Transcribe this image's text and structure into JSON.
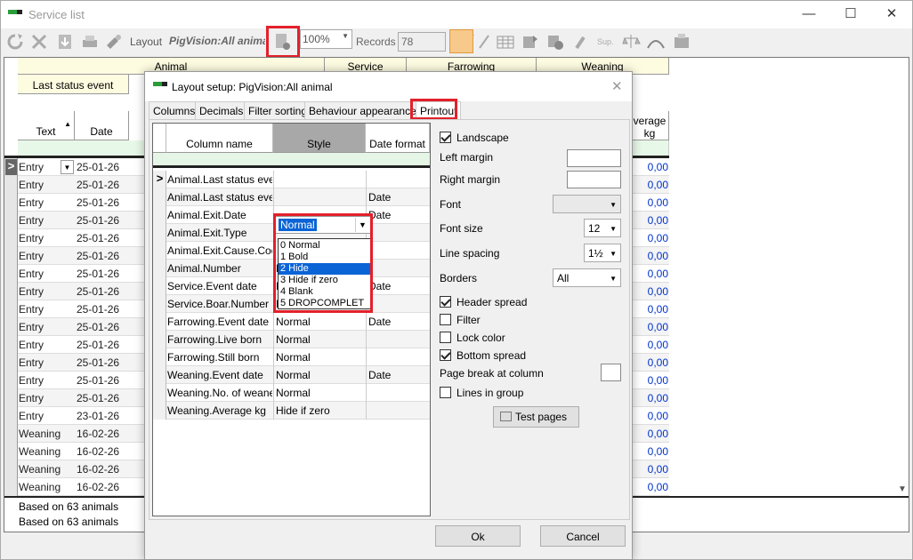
{
  "window": {
    "title": "Service list",
    "controls": {
      "minimize": "—",
      "maximize": "☐",
      "close": "✕"
    }
  },
  "toolbar": {
    "layout_label": "Layout",
    "layout_name": "PigVision:All animal",
    "zoom": "100%",
    "records_label": "Records",
    "records_value": "78",
    "icons": [
      "refresh-icon",
      "delete-icon",
      "download-icon",
      "print-icon",
      "tools-icon",
      "layout-setup-icon",
      "filter-icon",
      "pen-icon",
      "table-icon",
      "export-icon",
      "graph-icon",
      "brush-icon",
      "sup-icon",
      "scale-icon",
      "curve-icon",
      "machine-icon"
    ]
  },
  "grid": {
    "groups": [
      "Animal",
      "Service",
      "Farrowing",
      "Weaning"
    ],
    "sub_header": "Last status event",
    "col_text": "Text",
    "col_date": "Date",
    "col_avg": "verage kg",
    "rows": [
      {
        "text": "Entry",
        "date": "25-01-26",
        "val": "0,00"
      },
      {
        "text": "Entry",
        "date": "25-01-26",
        "val": "0,00"
      },
      {
        "text": "Entry",
        "date": "25-01-26",
        "val": "0,00"
      },
      {
        "text": "Entry",
        "date": "25-01-26",
        "val": "0,00"
      },
      {
        "text": "Entry",
        "date": "25-01-26",
        "val": "0,00"
      },
      {
        "text": "Entry",
        "date": "25-01-26",
        "val": "0,00"
      },
      {
        "text": "Entry",
        "date": "25-01-26",
        "val": "0,00"
      },
      {
        "text": "Entry",
        "date": "25-01-26",
        "val": "0,00"
      },
      {
        "text": "Entry",
        "date": "25-01-26",
        "val": "0,00"
      },
      {
        "text": "Entry",
        "date": "25-01-26",
        "val": "0,00"
      },
      {
        "text": "Entry",
        "date": "25-01-26",
        "val": "0,00"
      },
      {
        "text": "Entry",
        "date": "25-01-26",
        "val": "0,00"
      },
      {
        "text": "Entry",
        "date": "25-01-26",
        "val": "0,00"
      },
      {
        "text": "Entry",
        "date": "25-01-26",
        "val": "0,00"
      },
      {
        "text": "Entry",
        "date": "23-01-26",
        "val": "0,00"
      },
      {
        "text": "Weaning",
        "date": "16-02-26",
        "val": "0,00"
      },
      {
        "text": "Weaning",
        "date": "16-02-26",
        "val": "0,00"
      },
      {
        "text": "Weaning",
        "date": "16-02-26",
        "val": "0,00"
      },
      {
        "text": "Weaning",
        "date": "16-02-26",
        "val": "0,00"
      }
    ],
    "footer1": "Based on 63  animals",
    "footer2": "Based on 63  animals"
  },
  "dialog": {
    "title": "Layout setup: PigVision:All animal",
    "close": "✕",
    "tabs": [
      "Columns",
      "Decimals",
      "Filter sorting",
      "Behaviour  appearance",
      "Printout"
    ],
    "active_tab": "Printout",
    "table": {
      "headers": [
        "Column name",
        "Style",
        "Date format"
      ],
      "rows": [
        {
          "name": "Animal.Last status event",
          "style": "",
          "date": ""
        },
        {
          "name": "Animal.Last status event",
          "style": "",
          "date": "Date"
        },
        {
          "name": "Animal.Exit.Date",
          "style": "",
          "date": "Date"
        },
        {
          "name": "Animal.Exit.Type",
          "style": "",
          "date": ""
        },
        {
          "name": "Animal.Exit.Cause.Code",
          "style": "",
          "date": ""
        },
        {
          "name": "Animal.Number",
          "style": "Bold",
          "date": ""
        },
        {
          "name": "Service.Event date",
          "style": "Normal",
          "date": "Date"
        },
        {
          "name": "Service.Boar.Number",
          "style": "Normal",
          "date": ""
        },
        {
          "name": "Farrowing.Event date",
          "style": "Normal",
          "date": "Date"
        },
        {
          "name": "Farrowing.Live born",
          "style": "Normal",
          "date": ""
        },
        {
          "name": "Farrowing.Still born",
          "style": "Normal",
          "date": ""
        },
        {
          "name": "Weaning.Event date",
          "style": "Normal",
          "date": "Date"
        },
        {
          "name": "Weaning.No. of weaned",
          "style": "Normal",
          "date": ""
        },
        {
          "name": "Weaning.Average kg",
          "style": "Hide if zero",
          "date": ""
        }
      ],
      "style_dropdown_value": "Normal",
      "style_options": [
        "0 Normal",
        "1 Bold",
        "2 Hide",
        "3 Hide if zero",
        "4 Blank",
        "5 DROPCOMPLET"
      ],
      "style_option_selected": "2 Hide"
    },
    "printout": {
      "landscape": "Landscape",
      "left_margin": "Left margin",
      "right_margin": "Right margin",
      "font": "Font",
      "font_size": "Font size",
      "font_size_value": "12",
      "line_spacing": "Line spacing",
      "line_spacing_value": "1½",
      "borders": "Borders",
      "borders_value": "All",
      "header_spread": "Header spread",
      "filter": "Filter",
      "lock_color": "Lock color",
      "bottom_spread": "Bottom spread",
      "page_break": "Page break at column",
      "lines_in_group": "Lines in group",
      "test_pages": "Test pages"
    },
    "ok": "Ok",
    "cancel": "Cancel"
  },
  "colors": {
    "highlight_red": "#e3202b",
    "selection_blue": "#0a64d6",
    "value_blue": "#0033cc"
  }
}
